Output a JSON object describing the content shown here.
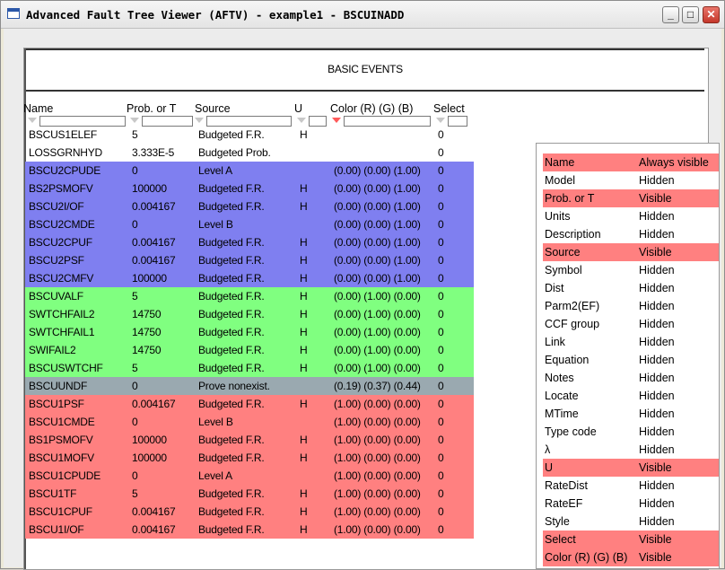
{
  "window": {
    "title": "Advanced Fault Tree Viewer (AFTV) - example1 - BSCUINADD",
    "controls": {
      "minimize": "_",
      "maximize": "□",
      "close": "✕"
    }
  },
  "panel": {
    "title": "BASIC EVENTS",
    "columns": [
      "Name",
      "Prob. or T",
      "Source",
      "U",
      "Color (R) (G) (B)",
      "Select"
    ]
  },
  "colors": {
    "blue": "#7f7ff0",
    "green": "#80ff80",
    "gray": "#9aa9b0",
    "red": "#ff8080",
    "visible_highlight": "#ff8080"
  },
  "rows": [
    {
      "name": "BSCUS1ELEF",
      "prob": "5",
      "source": "Budgeted F.R.",
      "u": "H",
      "color": "",
      "select": "0",
      "bg": ""
    },
    {
      "name": "LOSSGRNHYD",
      "prob": "3.333E-5",
      "source": "Budgeted Prob.",
      "u": "",
      "color": "",
      "select": "0",
      "bg": ""
    },
    {
      "name": "BSCU2CPUDE",
      "prob": "0",
      "source": "Level A",
      "u": "",
      "color": "(0.00) (0.00) (1.00)",
      "select": "0",
      "bg": "blue"
    },
    {
      "name": "BS2PSMOFV",
      "prob": "100000",
      "source": "Budgeted F.R.",
      "u": "H",
      "color": "(0.00) (0.00) (1.00)",
      "select": "0",
      "bg": "blue"
    },
    {
      "name": "BSCU2I/OF",
      "prob": "0.004167",
      "source": "Budgeted F.R.",
      "u": "H",
      "color": "(0.00) (0.00) (1.00)",
      "select": "0",
      "bg": "blue"
    },
    {
      "name": "BSCU2CMDE",
      "prob": "0",
      "source": "Level B",
      "u": "",
      "color": "(0.00) (0.00) (1.00)",
      "select": "0",
      "bg": "blue"
    },
    {
      "name": "BSCU2CPUF",
      "prob": "0.004167",
      "source": "Budgeted F.R.",
      "u": "H",
      "color": "(0.00) (0.00) (1.00)",
      "select": "0",
      "bg": "blue"
    },
    {
      "name": "BSCU2PSF",
      "prob": "0.004167",
      "source": "Budgeted F.R.",
      "u": "H",
      "color": "(0.00) (0.00) (1.00)",
      "select": "0",
      "bg": "blue"
    },
    {
      "name": "BSCU2CMFV",
      "prob": "100000",
      "source": "Budgeted F.R.",
      "u": "H",
      "color": "(0.00) (0.00) (1.00)",
      "select": "0",
      "bg": "blue"
    },
    {
      "name": "BSCUVALF",
      "prob": "5",
      "source": "Budgeted F.R.",
      "u": "H",
      "color": "(0.00) (1.00) (0.00)",
      "select": "0",
      "bg": "green"
    },
    {
      "name": "SWTCHFAIL2",
      "prob": "14750",
      "source": "Budgeted F.R.",
      "u": "H",
      "color": "(0.00) (1.00) (0.00)",
      "select": "0",
      "bg": "green"
    },
    {
      "name": "SWTCHFAIL1",
      "prob": "14750",
      "source": "Budgeted F.R.",
      "u": "H",
      "color": "(0.00) (1.00) (0.00)",
      "select": "0",
      "bg": "green"
    },
    {
      "name": "SWIFAIL2",
      "prob": "14750",
      "source": "Budgeted F.R.",
      "u": "H",
      "color": "(0.00) (1.00) (0.00)",
      "select": "0",
      "bg": "green"
    },
    {
      "name": "BSCUSWTCHF",
      "prob": "5",
      "source": "Budgeted F.R.",
      "u": "H",
      "color": "(0.00) (1.00) (0.00)",
      "select": "0",
      "bg": "green"
    },
    {
      "name": "BSCUUNDF",
      "prob": "0",
      "source": "Prove nonexist.",
      "u": "",
      "color": "(0.19) (0.37) (0.44)",
      "select": "0",
      "bg": "gray"
    },
    {
      "name": "BSCU1PSF",
      "prob": "0.004167",
      "source": "Budgeted F.R.",
      "u": "H",
      "color": "(1.00) (0.00) (0.00)",
      "select": "0",
      "bg": "red"
    },
    {
      "name": "BSCU1CMDE",
      "prob": "0",
      "source": "Level B",
      "u": "",
      "color": "(1.00) (0.00) (0.00)",
      "select": "0",
      "bg": "red"
    },
    {
      "name": "BS1PSMOFV",
      "prob": "100000",
      "source": "Budgeted F.R.",
      "u": "H",
      "color": "(1.00) (0.00) (0.00)",
      "select": "0",
      "bg": "red"
    },
    {
      "name": "BSCU1MOFV",
      "prob": "100000",
      "source": "Budgeted F.R.",
      "u": "H",
      "color": "(1.00) (0.00) (0.00)",
      "select": "0",
      "bg": "red"
    },
    {
      "name": "BSCU1CPUDE",
      "prob": "0",
      "source": "Level A",
      "u": "",
      "color": "(1.00) (0.00) (0.00)",
      "select": "0",
      "bg": "red"
    },
    {
      "name": "BSCU1TF",
      "prob": "5",
      "source": "Budgeted F.R.",
      "u": "H",
      "color": "(1.00) (0.00) (0.00)",
      "select": "0",
      "bg": "red"
    },
    {
      "name": "BSCU1CPUF",
      "prob": "0.004167",
      "source": "Budgeted F.R.",
      "u": "H",
      "color": "(1.00) (0.00) (0.00)",
      "select": "0",
      "bg": "red"
    },
    {
      "name": "BSCU1I/OF",
      "prob": "0.004167",
      "source": "Budgeted F.R.",
      "u": "H",
      "color": "(1.00) (0.00) (0.00)",
      "select": "0",
      "bg": "red"
    }
  ],
  "visibility": [
    {
      "field": "Name",
      "state": "Always visible",
      "highlight": true
    },
    {
      "field": "Model",
      "state": "Hidden",
      "highlight": false
    },
    {
      "field": "Prob. or T",
      "state": "Visible",
      "highlight": true
    },
    {
      "field": "Units",
      "state": "Hidden",
      "highlight": false
    },
    {
      "field": "Description",
      "state": "Hidden",
      "highlight": false
    },
    {
      "field": "Source",
      "state": "Visible",
      "highlight": true
    },
    {
      "field": "Symbol",
      "state": "Hidden",
      "highlight": false
    },
    {
      "field": "Dist",
      "state": "Hidden",
      "highlight": false
    },
    {
      "field": "Parm2(EF)",
      "state": "Hidden",
      "highlight": false
    },
    {
      "field": "CCF group",
      "state": "Hidden",
      "highlight": false
    },
    {
      "field": "Link",
      "state": "Hidden",
      "highlight": false
    },
    {
      "field": "Equation",
      "state": "Hidden",
      "highlight": false
    },
    {
      "field": "Notes",
      "state": "Hidden",
      "highlight": false
    },
    {
      "field": "Locate",
      "state": "Hidden",
      "highlight": false
    },
    {
      "field": "MTime",
      "state": "Hidden",
      "highlight": false
    },
    {
      "field": "Type code",
      "state": "Hidden",
      "highlight": false
    },
    {
      "field": "λ",
      "state": "Hidden",
      "highlight": false
    },
    {
      "field": "U",
      "state": "Visible",
      "highlight": true
    },
    {
      "field": "RateDist",
      "state": "Hidden",
      "highlight": false
    },
    {
      "field": "RateEF",
      "state": "Hidden",
      "highlight": false
    },
    {
      "field": "Style",
      "state": "Hidden",
      "highlight": false
    },
    {
      "field": "Select",
      "state": "Visible",
      "highlight": true
    },
    {
      "field": "Color (R) (G) (B)",
      "state": "Visible",
      "highlight": true
    }
  ]
}
